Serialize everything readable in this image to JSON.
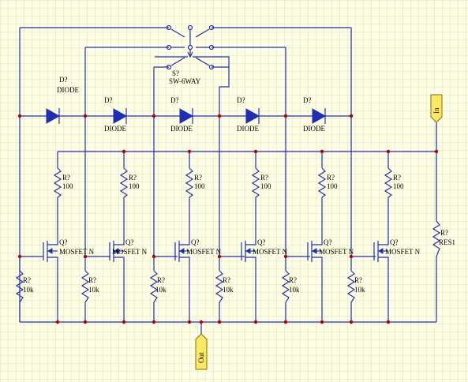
{
  "switch": {
    "designator": "S?",
    "value": "SW-6WAY"
  },
  "diode": {
    "designator": "D?",
    "value": "DIODE"
  },
  "gate_resistor": {
    "designator": "R?",
    "value": "100"
  },
  "pulldown_resistor": {
    "designator": "R?",
    "value": "10k"
  },
  "mosfet": {
    "designator": "Q?",
    "value": "MOSFET N"
  },
  "input_resistor": {
    "designator": "R?",
    "value": "RES1"
  },
  "ports": {
    "in": "In",
    "out": "Out"
  },
  "colors": {
    "background": "#ffffe6",
    "grid": "#d4d4b4",
    "wire": "#1f2fb4",
    "junction": "#b00000",
    "port": "#ffe866"
  }
}
